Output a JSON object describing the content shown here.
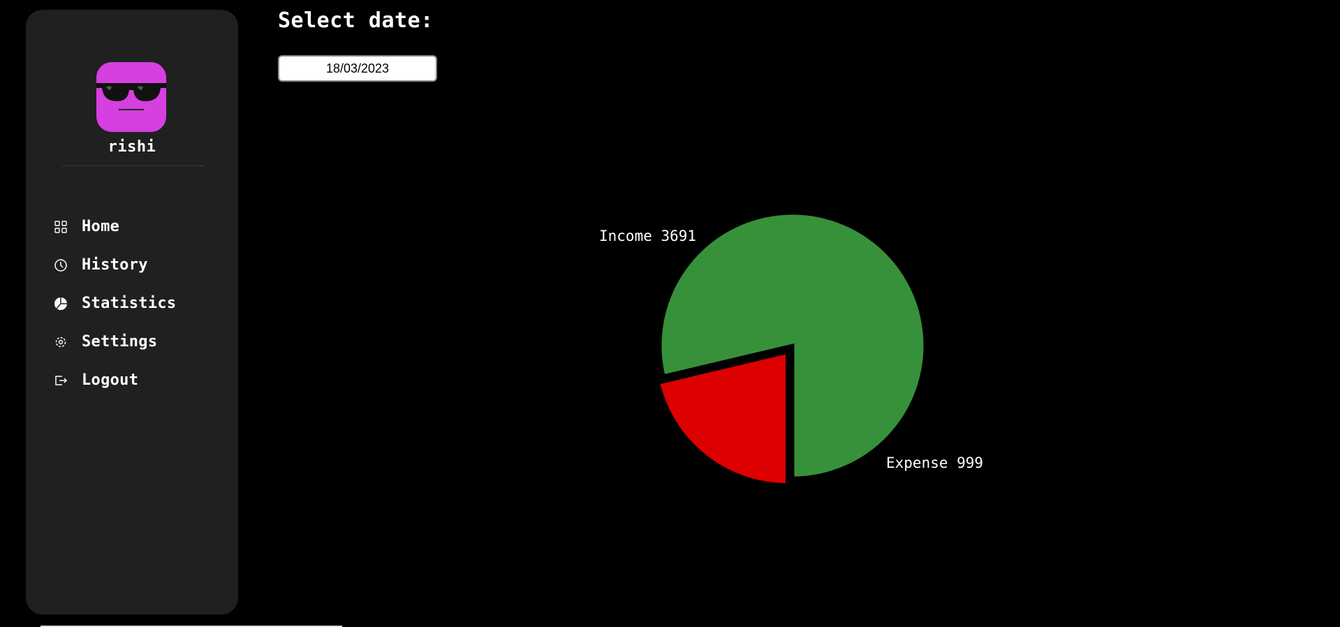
{
  "user": {
    "name": "rishi"
  },
  "nav": [
    {
      "label": "Home",
      "icon": "grid-icon"
    },
    {
      "label": "History",
      "icon": "clock-icon"
    },
    {
      "label": "Statistics",
      "icon": "pie-chart-icon"
    },
    {
      "label": "Settings",
      "icon": "gear-icon"
    },
    {
      "label": "Logout",
      "icon": "logout-icon"
    }
  ],
  "date": {
    "heading": "Select date:",
    "value": "18/03/2023"
  },
  "colors": {
    "income": "#37913a",
    "expense": "#dd0000",
    "avatar": "#d63fe0",
    "sidebar": "#202020"
  },
  "chart_data": {
    "type": "pie",
    "title": "",
    "slices": [
      {
        "label": "Income",
        "value": 3691,
        "display": "Income 3691",
        "color": "#37913a"
      },
      {
        "label": "Expense",
        "value": 999,
        "display": "Expense 999",
        "color": "#dd0000"
      }
    ],
    "legend": "none"
  }
}
